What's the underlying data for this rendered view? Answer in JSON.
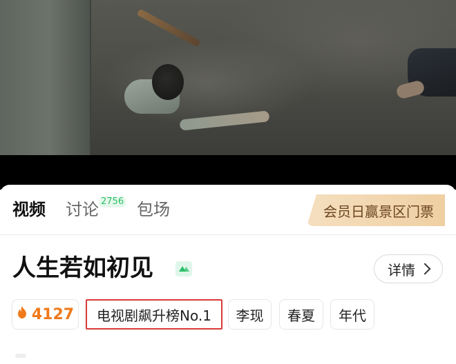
{
  "tabs": [
    {
      "label": "视频",
      "active": true
    },
    {
      "label": "讨论",
      "badge": "2756",
      "active": false
    },
    {
      "label": "包场",
      "active": false
    }
  ],
  "member_ticket": {
    "label": "会员日赢景区门票"
  },
  "show": {
    "title": "人生若如初见",
    "details_label": "详情",
    "heat": "4127",
    "rank_tag": "电视剧飙升榜No.1",
    "tags": [
      "李现",
      "春夏",
      "年代"
    ]
  },
  "colors": {
    "heat": "#f07a1b",
    "badge": "#2bbf67",
    "highlight_box": "#d83a37",
    "ticket_bg": "#efcfa2"
  },
  "icons": {
    "heat": "flame-icon",
    "rank": "trend-up-icon",
    "details": "chevron-right-icon"
  }
}
